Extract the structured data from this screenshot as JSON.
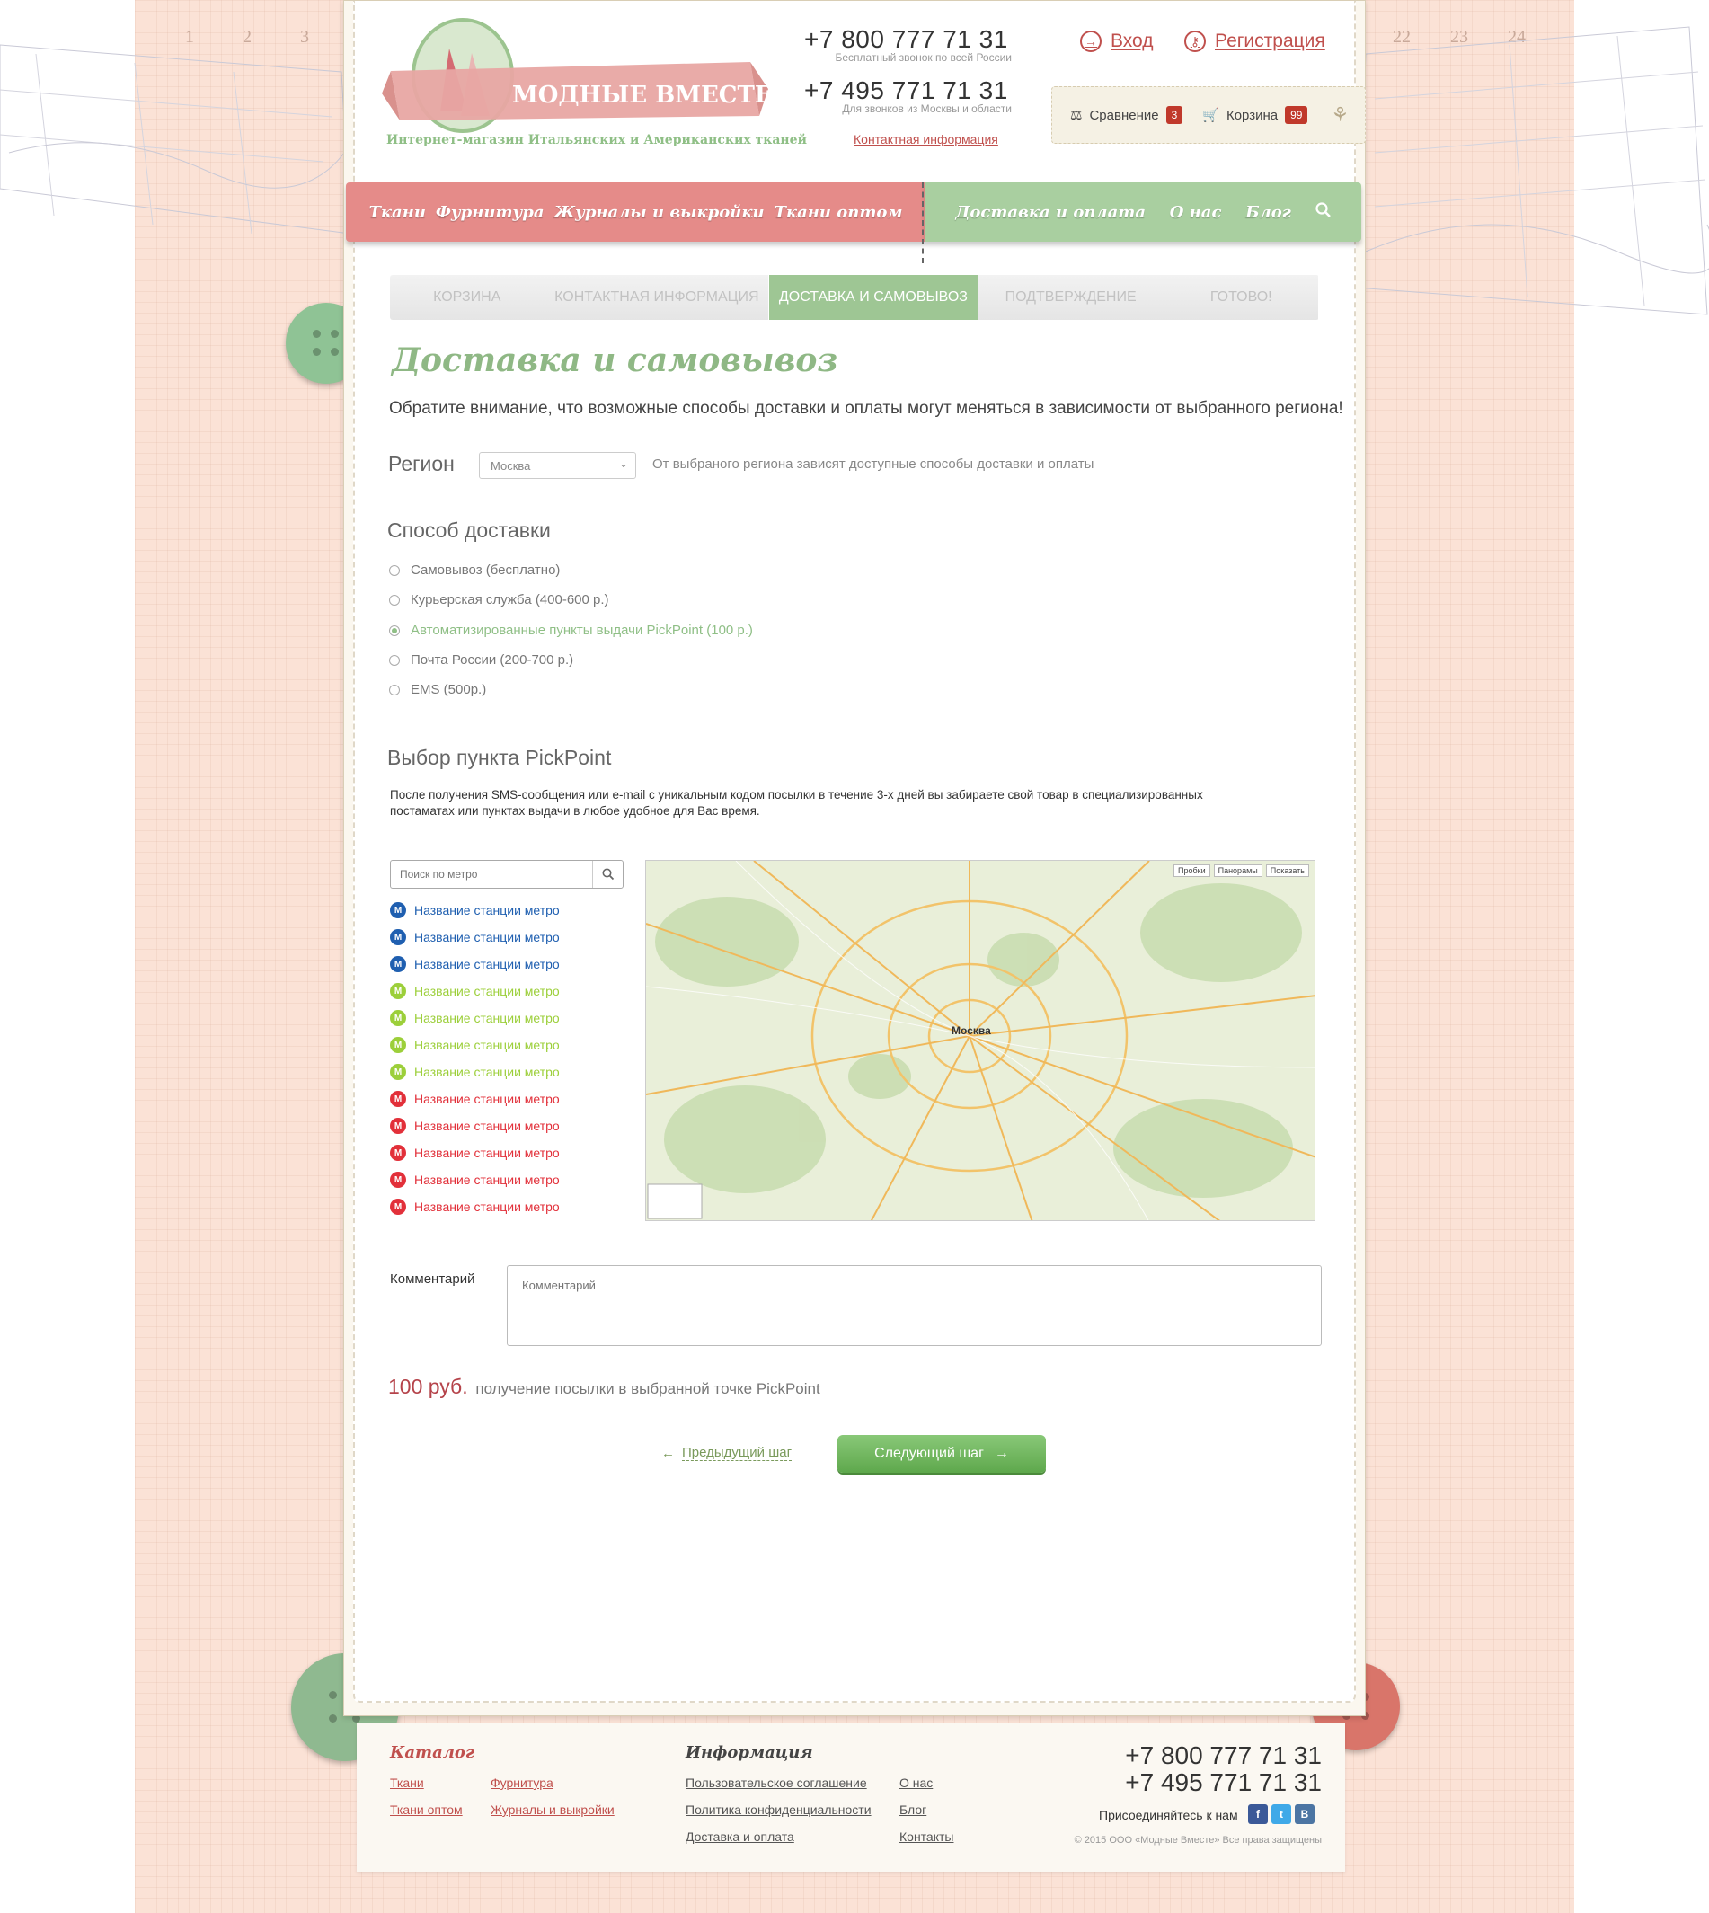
{
  "ruler": {
    "left": [
      "1",
      "2",
      "3"
    ],
    "right": [
      "22",
      "23",
      "24"
    ]
  },
  "logo": {
    "name": "МОДНЫЕ ВМЕСТЕ",
    "tagline": "Интернет-магазин Итальянских и Американских тканей"
  },
  "header": {
    "phone1": "+7 800 777 71 31",
    "phone1_note": "Бесплатный звонок по всей России",
    "phone2": "+7 495 771 71 31",
    "phone2_note": "Для звонков из Москвы и области",
    "contacts_link": "Контактная информация",
    "login": "Вход",
    "register": "Регистрация",
    "compare_label": "Сравнение",
    "compare_count": "3",
    "cart_label": "Корзина",
    "cart_count": "99"
  },
  "nav": {
    "pink": [
      "Ткани",
      "Фурнитура",
      "Журналы и выкройки",
      "Ткани оптом"
    ],
    "green": [
      "Доставка и оплата",
      "О нас",
      "Блог"
    ]
  },
  "steps": [
    {
      "label": "Корзина",
      "active": false
    },
    {
      "label": "Контактная информация",
      "active": false
    },
    {
      "label": "Доставка и самовывоз",
      "active": true
    },
    {
      "label": "Подтверждение",
      "active": false
    },
    {
      "label": "Готово!",
      "active": false
    }
  ],
  "page": {
    "title": "Доставка и самовывоз",
    "notice": "Обратите внимание, что возможные способы доставки и оплаты могут меняться в зависимости от выбранного региона!",
    "region_label": "Регион",
    "region_value": "Москва",
    "region_hint": "От выбраного региона зависят доступные способы доставки и оплаты",
    "delivery_heading": "Способ доставки",
    "delivery_options": [
      {
        "label": "Самовывоз (бесплатно)",
        "checked": false
      },
      {
        "label": "Курьерская служба (400-600 р.)",
        "checked": false
      },
      {
        "label": "Автоматизированные пункты выдачи PickPoint (100 р.)",
        "checked": true
      },
      {
        "label": "Почта России (200-700 р.)",
        "checked": false
      },
      {
        "label": "EMS (500р.)",
        "checked": false
      }
    ],
    "pickpoint_heading": "Выбор пункта PickPoint",
    "pickpoint_desc": "После получения SMS-сообщения или e-mail с уникальным кодом посылки в течение 3-х дней вы забираете свой товар в специализированных постаматах или пунктах выдачи в любое удобное для Вас время.",
    "metro_placeholder": "Поиск по метро",
    "metro_stations": [
      {
        "label": "Название станции метро",
        "color": "#1f5fb0"
      },
      {
        "label": "Название станции метро",
        "color": "#1f5fb0"
      },
      {
        "label": "Название станции метро",
        "color": "#1f5fb0"
      },
      {
        "label": "Название станции метро",
        "color": "#9ccf3a"
      },
      {
        "label": "Название станции метро",
        "color": "#9ccf3a"
      },
      {
        "label": "Название станции метро",
        "color": "#9ccf3a"
      },
      {
        "label": "Название станции метро",
        "color": "#9ccf3a"
      },
      {
        "label": "Название станции метро",
        "color": "#e2303a"
      },
      {
        "label": "Название станции метро",
        "color": "#e2303a"
      },
      {
        "label": "Название станции метро",
        "color": "#e2303a"
      },
      {
        "label": "Название станции метро",
        "color": "#e2303a"
      },
      {
        "label": "Название станции метро",
        "color": "#e2303a"
      }
    ],
    "map_city": "Москва",
    "map_controls": [
      "Пробки",
      "Панорамы",
      "Показать"
    ],
    "comment_label": "Комментарий",
    "comment_placeholder": "Комментарий",
    "price": "100 руб.",
    "price_text": "получение посылки в выбранной точке PickPoint",
    "prev_step": "Предыдущий шаг",
    "next_step": "Следующий шаг"
  },
  "footer": {
    "catalog_heading": "Каталог",
    "catalog_links": [
      "Ткани",
      "Ткани оптом",
      "Фурнитура",
      "Журналы и выкройки"
    ],
    "info_heading": "Информация",
    "info_links": [
      "Пользовательское соглашение",
      "Политика конфиденциальности",
      "Доставка и оплата",
      "О нас",
      "Блог",
      "Контакты"
    ],
    "phone1": "+7 800 777 71 31",
    "phone2": "+7 495 771 71 31",
    "join": "Присоединяйтесь к нам",
    "copyright": "© 2015 ООО «Модные Вместе» Все права защищены"
  },
  "colors": {
    "pink": "#e58b89",
    "green": "#a9cfa0",
    "link_red": "#c0504d",
    "accent_green": "#8fbf86"
  }
}
